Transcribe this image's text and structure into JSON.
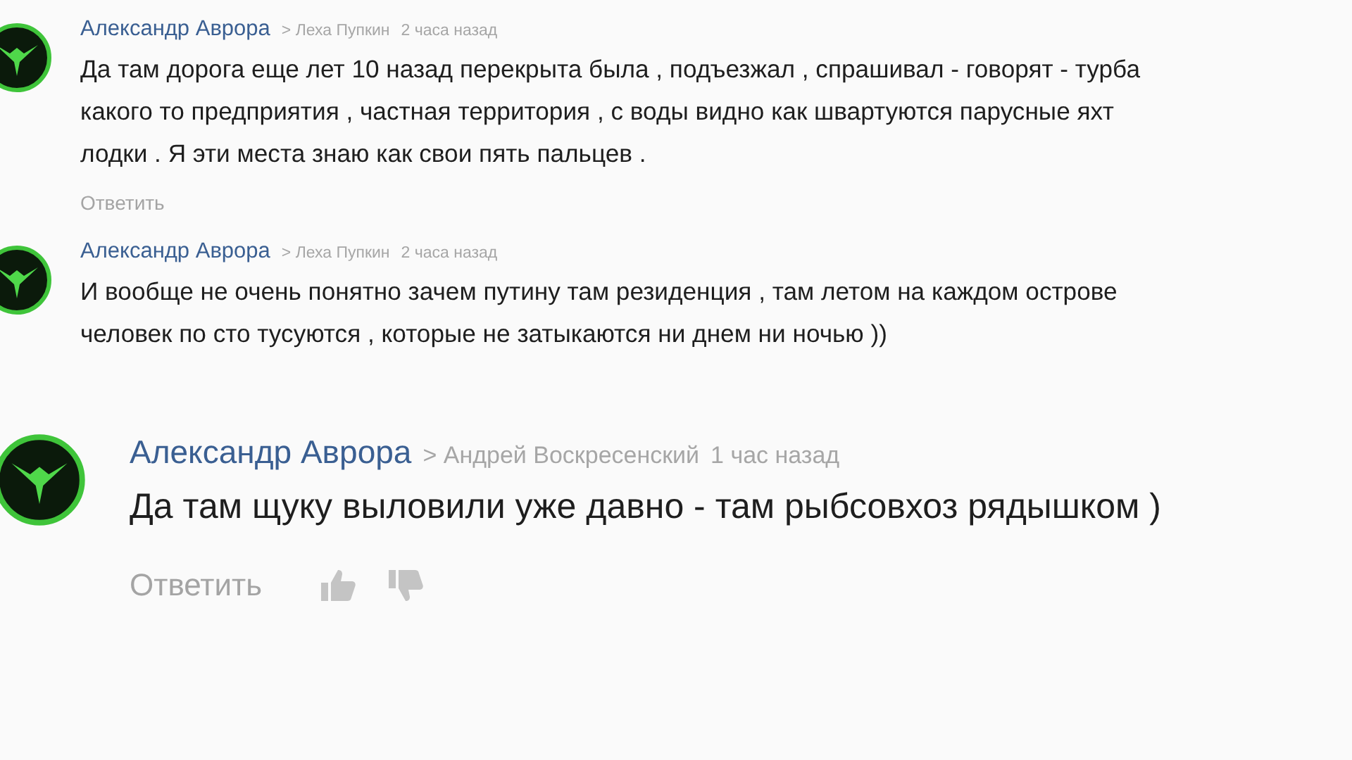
{
  "comments": [
    {
      "kind": "small",
      "author": "Александр Аврора",
      "reply_to": "> Леха Пупкин",
      "time": "2 часа назад",
      "lines": [
        "Да там дорога еще лет 10 назад перекрыта была , подъезжал , спрашивал - говорят - турба",
        "какого то предприятия , частная территория , с воды видно как швартуются парусные яхт",
        "лодки . Я эти места знаю как свои пять пальцев ."
      ],
      "reply": "Ответить"
    },
    {
      "kind": "small",
      "author": "Александр Аврора",
      "reply_to": "> Леха Пупкин",
      "time": "2 часа назад",
      "lines": [
        "И вообще не очень понятно зачем путину там резиденция , там летом на каждом острове",
        "человек по сто тусуются , которые не затыкаются ни днем ни ночью ))"
      ]
    },
    {
      "kind": "large",
      "author": "Александр Аврора",
      "reply_to": "> Андрей Воскресенский",
      "time": "1 час назад",
      "lines": [
        "Да там щуку выловили уже давно - там рыбсовхоз рядышком )"
      ],
      "reply": "Ответить"
    }
  ]
}
